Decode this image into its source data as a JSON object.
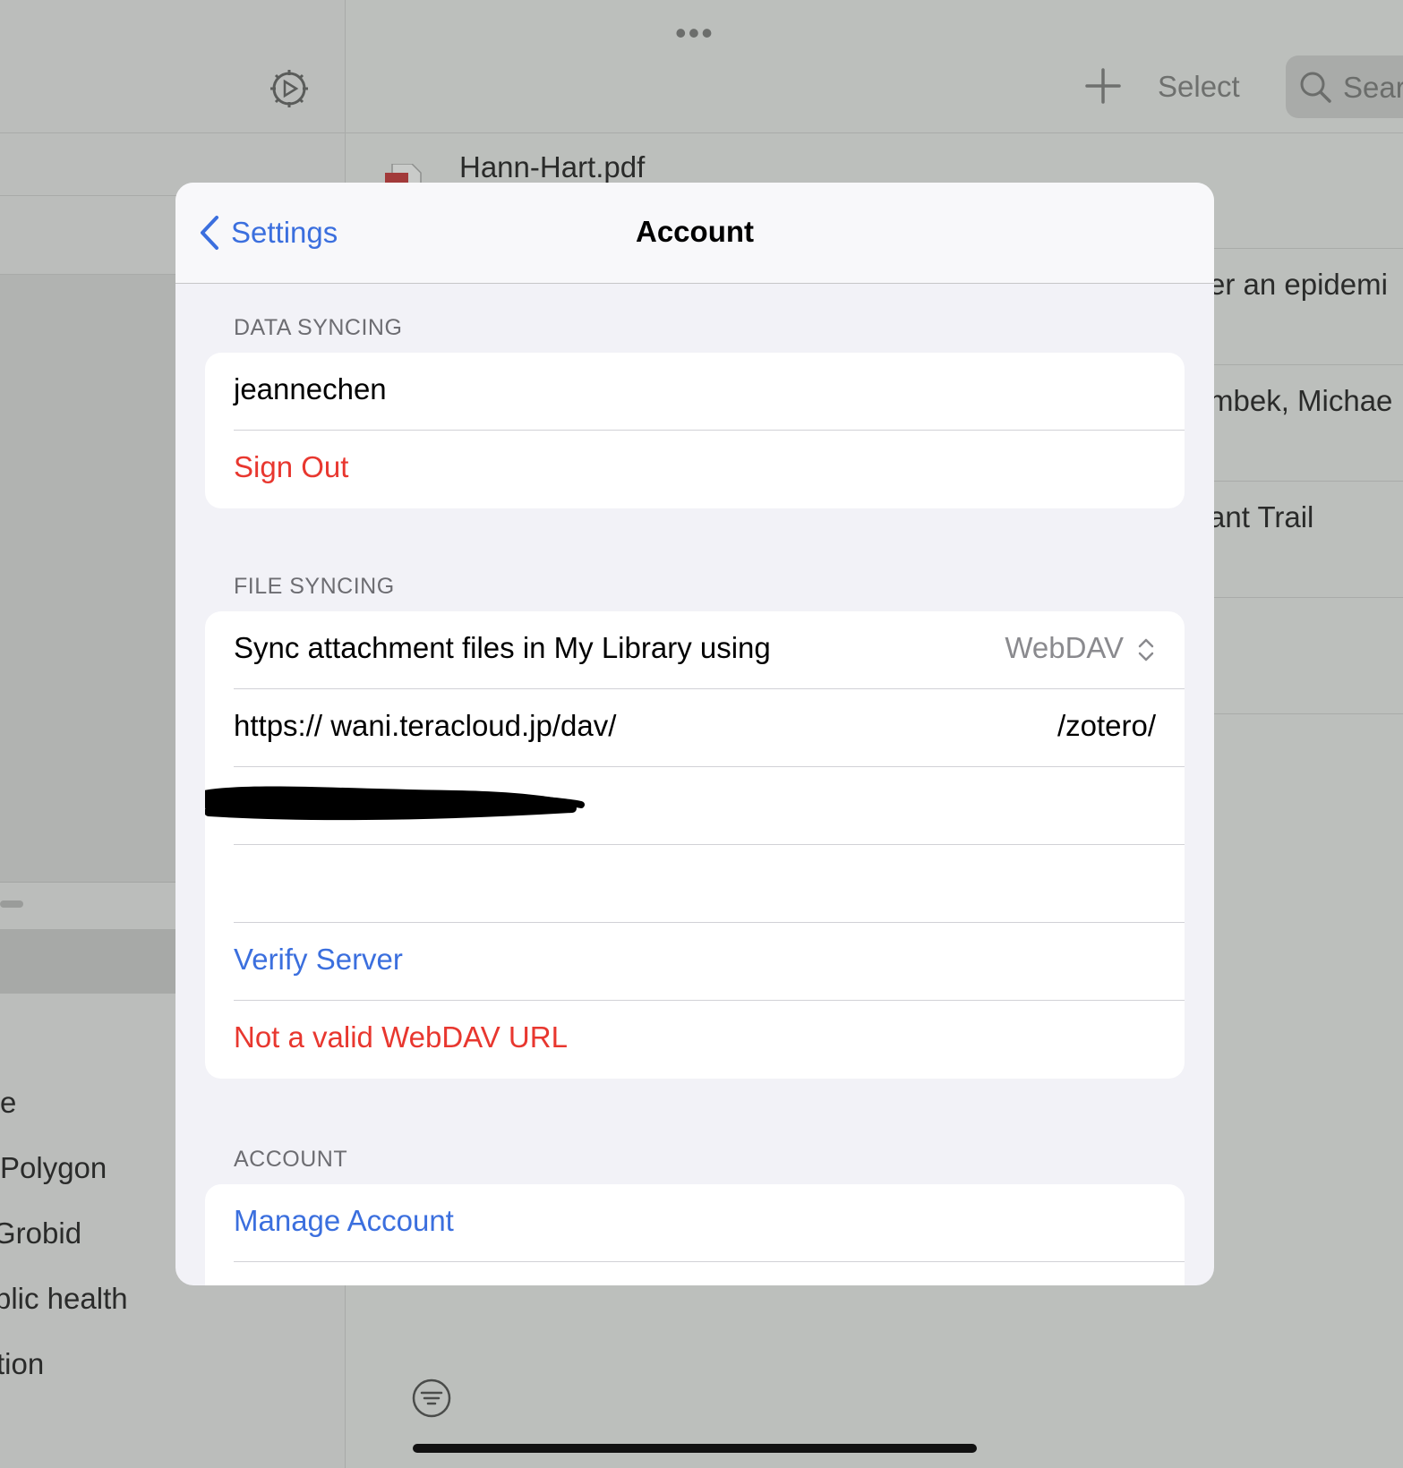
{
  "background": {
    "sidebar": {
      "items": [
        "e",
        "Polygon",
        "Grobid",
        "blic health",
        "tion"
      ]
    },
    "main": {
      "more_dots": "•••",
      "select_label": "Select",
      "search_placeholder": "Sear",
      "items": [
        "Hann-Hart.pdf",
        "er an epidemi",
        "mbek, Michae",
        "ant Trail"
      ]
    }
  },
  "modal": {
    "back_label": "Settings",
    "title": "Account",
    "data_syncing": {
      "header": "DATA SYNCING",
      "username": "jeannechen",
      "sign_out": "Sign Out"
    },
    "file_syncing": {
      "header": "FILE SYNCING",
      "sync_label": "Sync attachment files in My Library using",
      "sync_method": "WebDAV",
      "url_value": "https:// wani.teracloud.jp/dav/",
      "url_suffix": "/zotero/",
      "verify_server": "Verify Server",
      "error_message": "Not a valid WebDAV URL"
    },
    "account": {
      "header": "ACCOUNT",
      "manage_account": "Manage Account"
    }
  },
  "colors": {
    "accent_blue": "#3b6fde",
    "destructive_red": "#e8372f",
    "modal_background": "#f2f2f7",
    "dimmed_background": "#bcbfbc"
  }
}
